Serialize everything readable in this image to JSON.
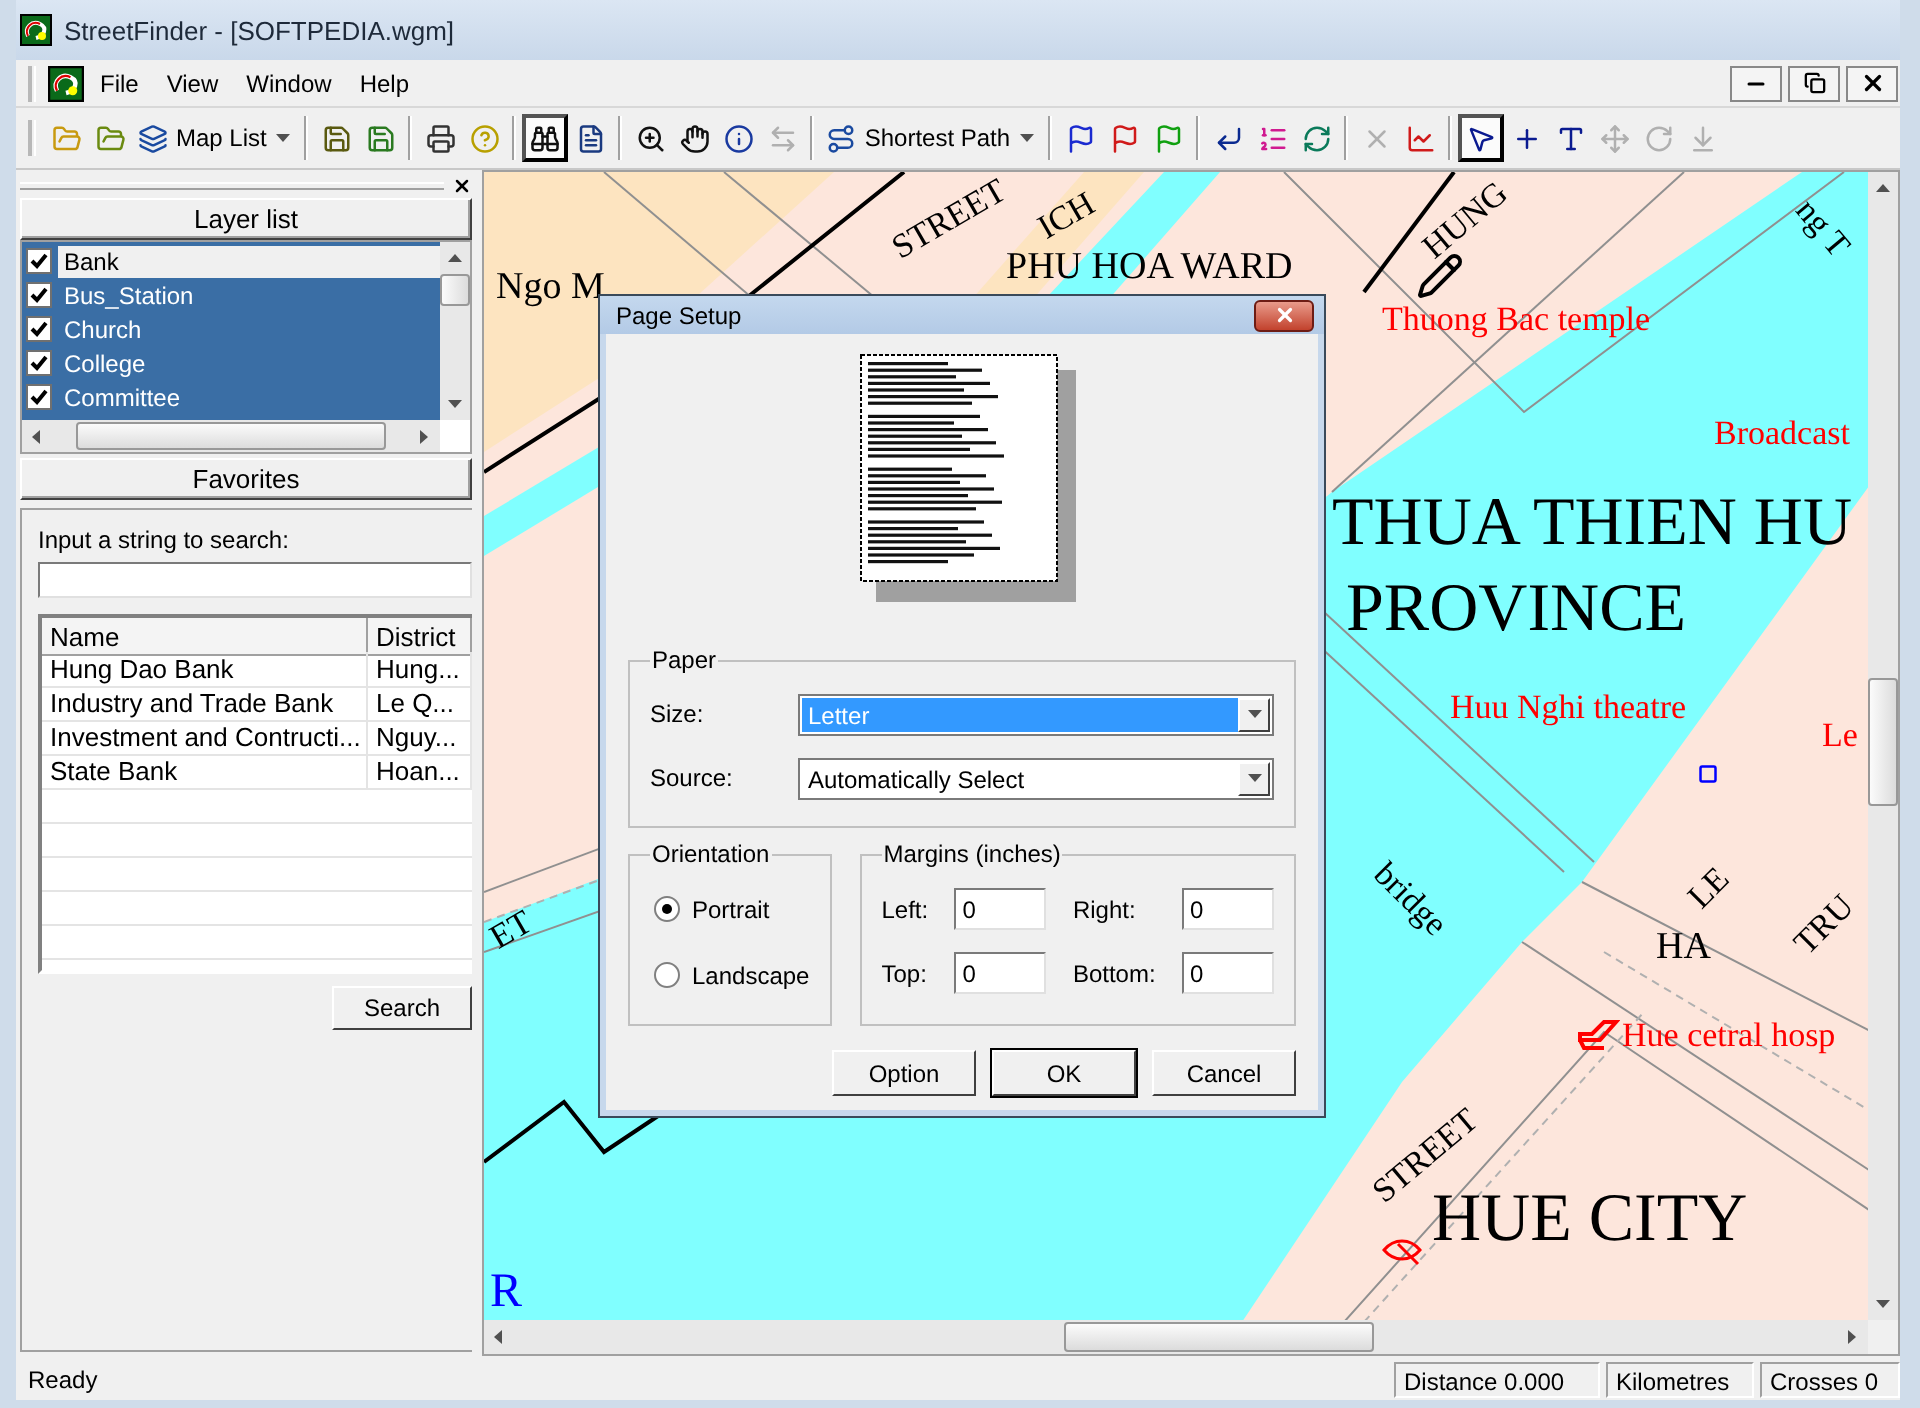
{
  "window": {
    "title": "StreetFinder - [SOFTPEDIA.wgm]"
  },
  "menu": [
    {
      "label": "File"
    },
    {
      "label": "View"
    },
    {
      "label": "Window"
    },
    {
      "label": "Help"
    }
  ],
  "toolbar": {
    "groups": [
      [
        {
          "kind": "open",
          "pressed": false,
          "disabled": false
        },
        {
          "kind": "open-map",
          "pressed": false,
          "disabled": false
        },
        {
          "kind": "map-list",
          "label": "Map List",
          "pressed": false,
          "disabled": false
        }
      ],
      [
        {
          "kind": "save",
          "pressed": false,
          "disabled": false
        },
        {
          "kind": "save-map",
          "pressed": false,
          "disabled": false
        }
      ],
      [
        {
          "kind": "print",
          "pressed": false,
          "disabled": false
        },
        {
          "kind": "help",
          "pressed": false,
          "disabled": false
        }
      ],
      [
        {
          "kind": "find",
          "pressed": true,
          "disabled": false
        },
        {
          "kind": "properties",
          "pressed": false,
          "disabled": false
        }
      ],
      [
        {
          "kind": "zoom",
          "pressed": false,
          "disabled": false
        },
        {
          "kind": "pan",
          "pressed": false,
          "disabled": false
        },
        {
          "kind": "info",
          "pressed": false,
          "disabled": false
        },
        {
          "kind": "measure",
          "pressed": false,
          "disabled": true
        }
      ],
      [
        {
          "kind": "shortest-path",
          "label": "Shortest Path",
          "pressed": false,
          "disabled": false
        }
      ],
      [
        {
          "kind": "start-flag",
          "pressed": false,
          "disabled": false
        },
        {
          "kind": "end-flag",
          "pressed": false,
          "disabled": false
        },
        {
          "kind": "via-flag",
          "pressed": false,
          "disabled": false
        }
      ],
      [
        {
          "kind": "return",
          "pressed": false,
          "disabled": false
        },
        {
          "kind": "order",
          "pressed": false,
          "disabled": false
        },
        {
          "kind": "loop",
          "pressed": false,
          "disabled": false
        }
      ],
      [
        {
          "kind": "clear",
          "pressed": false,
          "disabled": true
        },
        {
          "kind": "chart",
          "pressed": false,
          "disabled": false
        }
      ],
      [
        {
          "kind": "select",
          "pressed": true,
          "disabled": false
        },
        {
          "kind": "point",
          "pressed": false,
          "disabled": false
        },
        {
          "kind": "text",
          "pressed": false,
          "disabled": false
        },
        {
          "kind": "move",
          "pressed": false,
          "disabled": true
        },
        {
          "kind": "rotate",
          "pressed": false,
          "disabled": true
        },
        {
          "kind": "anchor",
          "pressed": false,
          "disabled": true
        }
      ]
    ]
  },
  "sidebar": {
    "layer_list": {
      "title": "Layer list",
      "items": [
        {
          "label": "Bank",
          "checked": true,
          "selected": false
        },
        {
          "label": "Bus_Station",
          "checked": true,
          "selected": true
        },
        {
          "label": "Church",
          "checked": true,
          "selected": true
        },
        {
          "label": "College",
          "checked": true,
          "selected": true
        },
        {
          "label": "Committee",
          "checked": true,
          "selected": true
        }
      ]
    },
    "favorites": {
      "title": "Favorites"
    },
    "search": {
      "label": "Input a string to search:",
      "columns": [
        "Name",
        "District"
      ],
      "rows": [
        [
          "Hung Dao Bank",
          "Hung..."
        ],
        [
          "Industry and Trade Bank",
          "Le Q..."
        ],
        [
          "Investment and Contructi...",
          "Nguy..."
        ],
        [
          "State Bank",
          "Hoan..."
        ]
      ],
      "button": "Search"
    }
  },
  "map": {
    "labels": [
      {
        "text": "Ngo M",
        "kind": "place"
      },
      {
        "text": "STREET",
        "kind": "street"
      },
      {
        "text": "ICH",
        "kind": "street"
      },
      {
        "text": "PHU HOA WARD",
        "kind": "place"
      },
      {
        "text": "HUNG",
        "kind": "street"
      },
      {
        "text": "ng T",
        "kind": "street"
      },
      {
        "text": "Thuong Bac temple",
        "kind": "poi"
      },
      {
        "text": "Broadcast",
        "kind": "poi"
      },
      {
        "text": "THUA THIEN HU",
        "kind": "region"
      },
      {
        "text": "PROVINCE",
        "kind": "region"
      },
      {
        "text": "Huu Nghi theatre",
        "kind": "poi"
      },
      {
        "text": "Le",
        "kind": "poi"
      },
      {
        "text": "bridge",
        "kind": "street"
      },
      {
        "text": "LE",
        "kind": "street"
      },
      {
        "text": "TRU",
        "kind": "street"
      },
      {
        "text": "HA",
        "kind": "place"
      },
      {
        "text": "Hue cetral hosp",
        "kind": "poi"
      },
      {
        "text": "STREET",
        "kind": "street"
      },
      {
        "text": "HUE CITY",
        "kind": "region"
      },
      {
        "text": "R",
        "kind": "water"
      },
      {
        "text": "ET",
        "kind": "street"
      }
    ]
  },
  "dialog": {
    "title": "Page Setup",
    "paper": {
      "legend": "Paper",
      "fields": [
        {
          "label": "Size:",
          "value": "Letter",
          "highlighted": true
        },
        {
          "label": "Source:",
          "value": "Automatically Select",
          "highlighted": false
        }
      ]
    },
    "orientation": {
      "legend": "Orientation",
      "options": [
        {
          "label": "Portrait",
          "selected": true
        },
        {
          "label": "Landscape",
          "selected": false
        }
      ]
    },
    "margins": {
      "legend": "Margins (inches)",
      "fields": [
        {
          "label": "Left:",
          "value": "0"
        },
        {
          "label": "Right:",
          "value": "0"
        },
        {
          "label": "Top:",
          "value": "0"
        },
        {
          "label": "Bottom:",
          "value": "0"
        }
      ]
    },
    "buttons": [
      {
        "label": "Option",
        "default": false
      },
      {
        "label": "OK",
        "default": true
      },
      {
        "label": "Cancel",
        "default": false
      }
    ]
  },
  "status_bar": [
    "Ready",
    "Distance 0.000",
    "Kilometres",
    "Crosses 0"
  ]
}
